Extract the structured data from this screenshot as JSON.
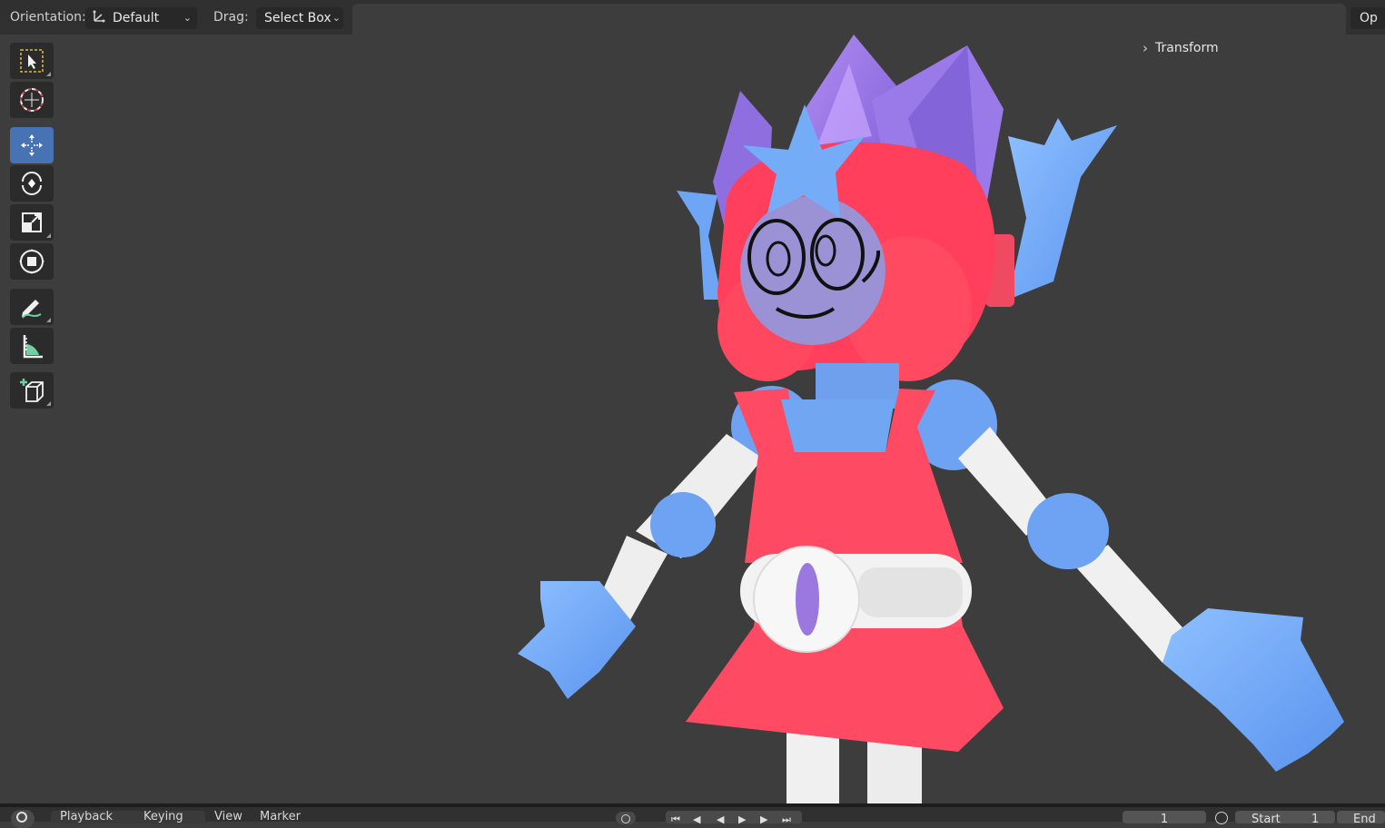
{
  "header": {
    "orientation_label": "Orientation:",
    "orientation_value": "Default",
    "drag_label": "Drag:",
    "drag_value": "Select Box",
    "right_button": "Op"
  },
  "toolbar": {
    "tools": [
      {
        "name": "select-box-tool",
        "active": false
      },
      {
        "name": "cursor-tool",
        "active": false
      },
      {
        "name": "move-tool",
        "active": true
      },
      {
        "name": "rotate-tool",
        "active": false
      },
      {
        "name": "scale-tool",
        "active": false
      },
      {
        "name": "transform-tool",
        "active": false
      },
      {
        "name": "annotate-tool",
        "active": false
      },
      {
        "name": "measure-tool",
        "active": false
      },
      {
        "name": "add-cube-tool",
        "active": false
      }
    ]
  },
  "sidebar": {
    "transform_label": "Transform"
  },
  "timeline": {
    "playback": "Playback",
    "keying": "Keying",
    "view": "View",
    "marker": "Marker",
    "current_frame": "1",
    "start_label": "Start",
    "start_value": "1",
    "end_label": "End"
  },
  "colors": {
    "accent": "#4772b3",
    "viewport_bg": "#3d3d3d",
    "header_bg": "#303030"
  }
}
